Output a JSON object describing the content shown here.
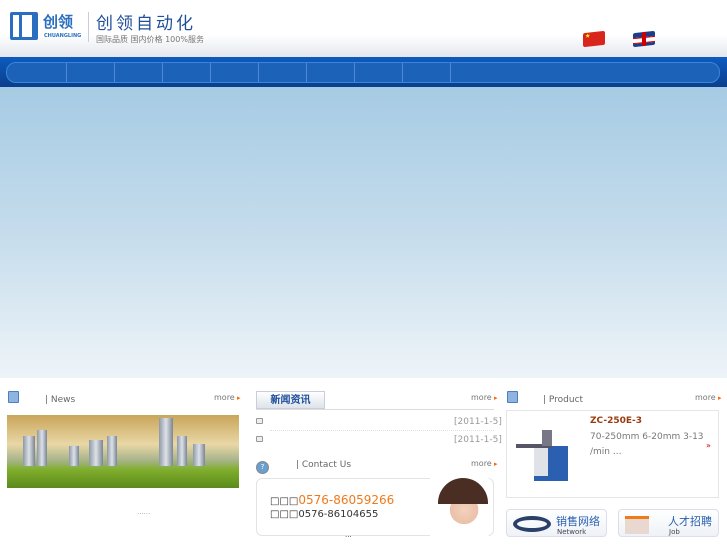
{
  "header": {
    "logo_cn": "创领",
    "logo_en": "CHUANGLING",
    "brand": "创领自动化",
    "slogan": "国际品质  国内价格  100%服务",
    "languages": [
      "中文",
      "English"
    ]
  },
  "nav": {
    "items": [
      "",
      "",
      "",
      "",
      "",
      "",
      "",
      "",
      "",
      ""
    ]
  },
  "news": {
    "title": "| News",
    "more": "more",
    "caption": "......"
  },
  "news_list": {
    "tab": "新闻资讯",
    "more": "more",
    "items": [
      {
        "title": "",
        "date": "[2011-1-5]"
      },
      {
        "title": "",
        "date": "[2011-1-5]"
      }
    ]
  },
  "contact": {
    "title": "| Contact Us",
    "more": "more",
    "phone_label": "□□□",
    "phone": "0576-86059266",
    "fax_label": "□□□",
    "fax": "0576-86104655",
    "footer": "..."
  },
  "product": {
    "title": "| Product",
    "more": "more",
    "name": "ZC-250E-3",
    "desc": "70-250mm    6-20mm    3-13 /min  ..."
  },
  "links": [
    {
      "cn": "销售网络",
      "en": "Network"
    },
    {
      "cn": "人才招聘",
      "en": "Job"
    }
  ]
}
